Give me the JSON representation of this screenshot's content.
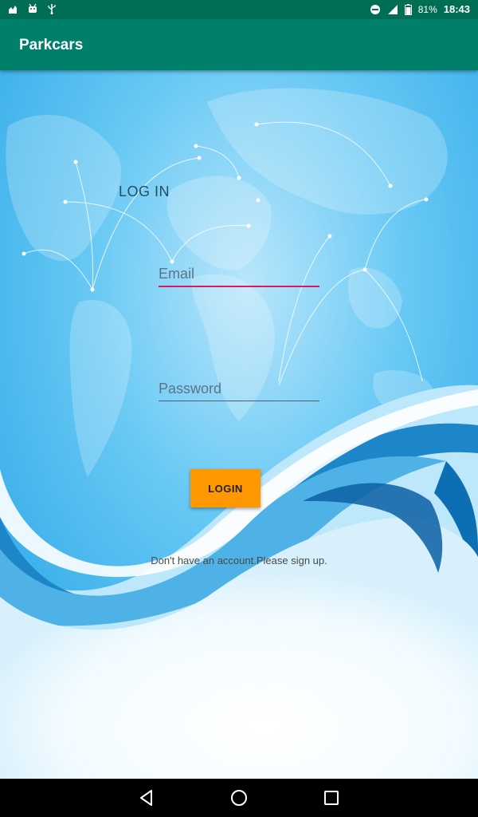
{
  "status_bar": {
    "icons_left": [
      "notification-icon",
      "android-icon",
      "usb-icon"
    ],
    "icons_right": [
      "do-not-disturb-icon",
      "signal-icon",
      "battery-icon"
    ],
    "battery": "81%",
    "time": "18:43"
  },
  "app_bar": {
    "title": "Parkcars"
  },
  "login": {
    "heading": "LOG IN",
    "email_placeholder": "Email",
    "password_placeholder": "Password",
    "button_label": "LOGIN",
    "signup_text": "Don't have an account.Please sign up."
  },
  "nav_bar": {
    "buttons": [
      "back-icon",
      "home-icon",
      "recents-icon"
    ]
  },
  "colors": {
    "status_bar": "#006e55",
    "app_bar": "#00806a",
    "accent": "#d81b60",
    "button": "#ff9800",
    "sky": "#4fbdf0"
  }
}
